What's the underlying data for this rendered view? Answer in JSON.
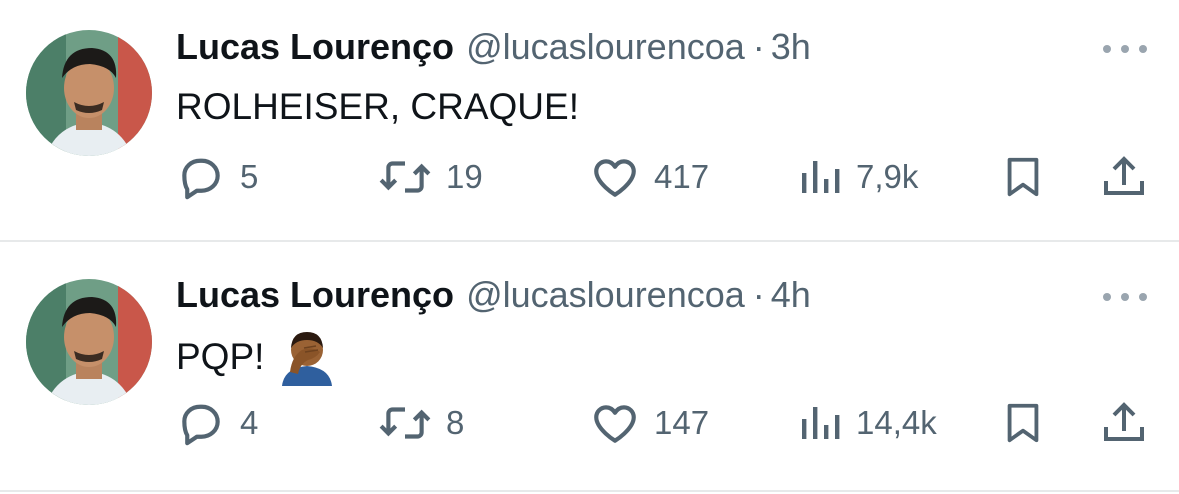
{
  "tweets": [
    {
      "name": "Lucas Lourenço",
      "handle": "@lucaslourencoa",
      "separator": "·",
      "time": "3h",
      "text": "ROLHEISER, CRAQUE!",
      "emoji": "",
      "replies": "5",
      "retweets": "19",
      "likes": "417",
      "views": "7,9k"
    },
    {
      "name": "Lucas Lourenço",
      "handle": "@lucaslourencoa",
      "separator": "·",
      "time": "4h",
      "text": "PQP!",
      "emoji": "facepalm-emoji",
      "replies": "4",
      "retweets": "8",
      "likes": "147",
      "views": "14,4k"
    }
  ],
  "colors": {
    "text_primary": "#0f1419",
    "text_secondary": "#536471",
    "divider": "#e7e9ea"
  }
}
